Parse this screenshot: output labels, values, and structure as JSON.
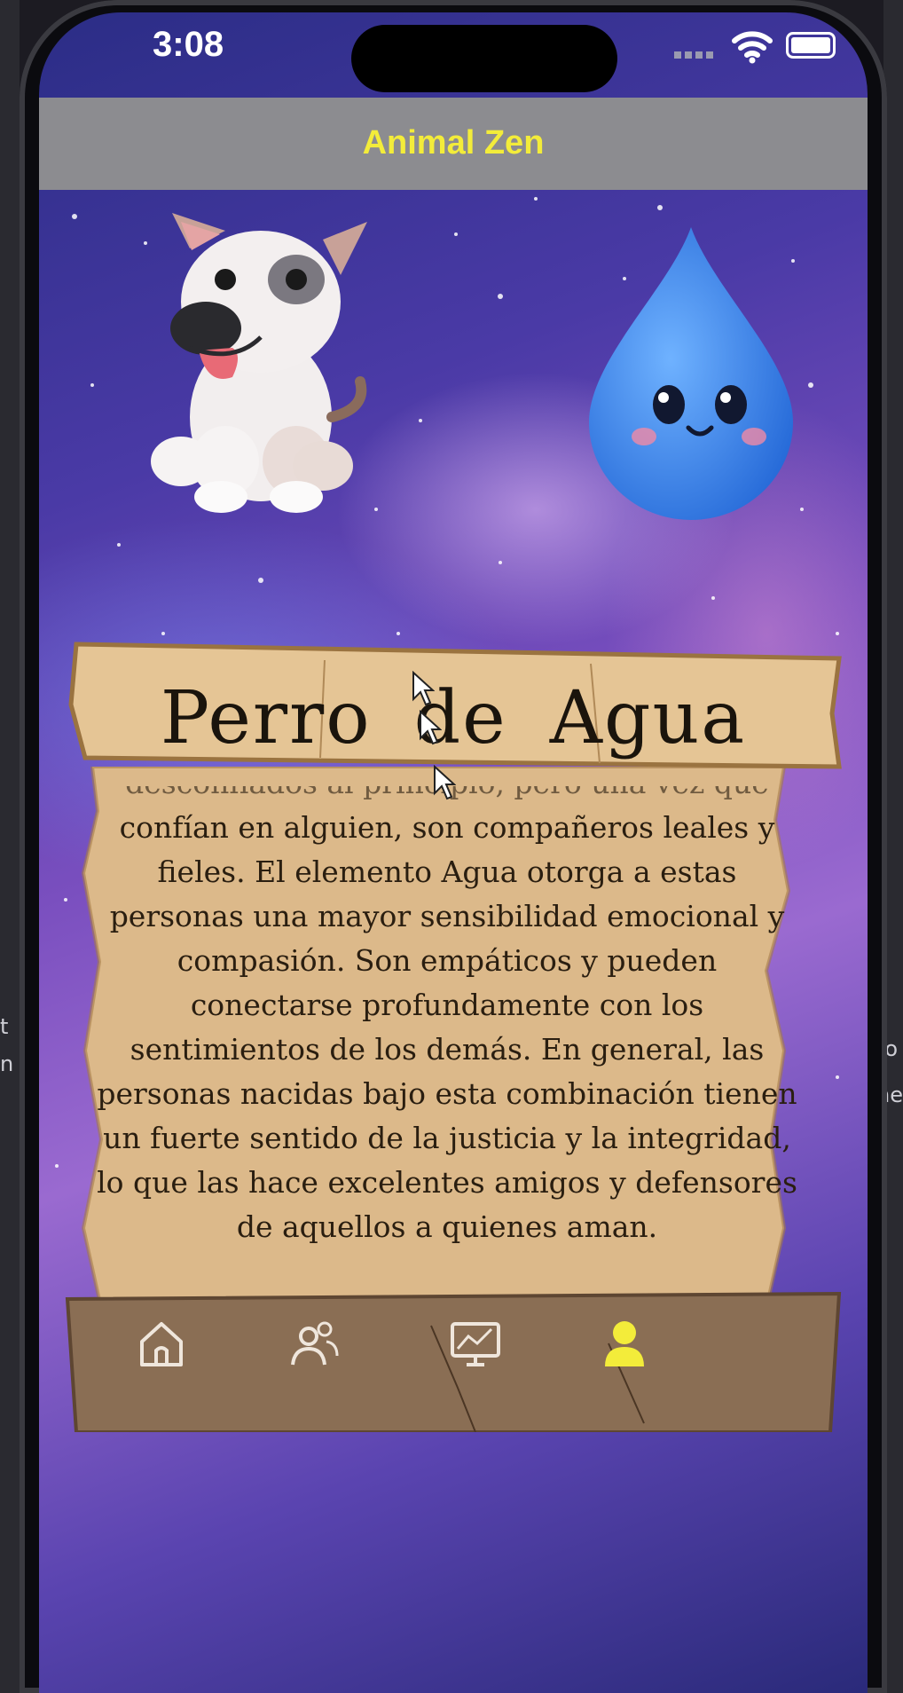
{
  "status": {
    "time": "3:08"
  },
  "header": {
    "title": "Animal Zen"
  },
  "hero": {
    "animal_icon": "dog-icon",
    "element_icon": "water-drop-icon"
  },
  "card": {
    "title": "Perro de Agua",
    "cut_line": "desconfiados al principio, pero una vez que",
    "description": "confían en alguien, son compañeros leales y fieles. El elemento Agua otorga a estas personas una mayor sensibilidad emocional y compasión. Son empáticos y pueden conectarse profundamente con los sentimientos de los demás. En general, las personas nacidas bajo esta combinación tienen un fuerte sentido de la justicia y la integridad, lo que las hace excelentes amigos y defensores de aquellos a quienes aman."
  },
  "tabbar": {
    "items": [
      {
        "icon": "home-icon",
        "active": false
      },
      {
        "icon": "people-icon",
        "active": false
      },
      {
        "icon": "chart-monitor-icon",
        "active": false
      },
      {
        "icon": "profile-icon",
        "active": true
      }
    ],
    "active_color": "#f3ec3a",
    "inactive_color": "#ffffff"
  },
  "background": {
    "side_left_text": "t\nn",
    "side_right_text": "to\nne"
  }
}
